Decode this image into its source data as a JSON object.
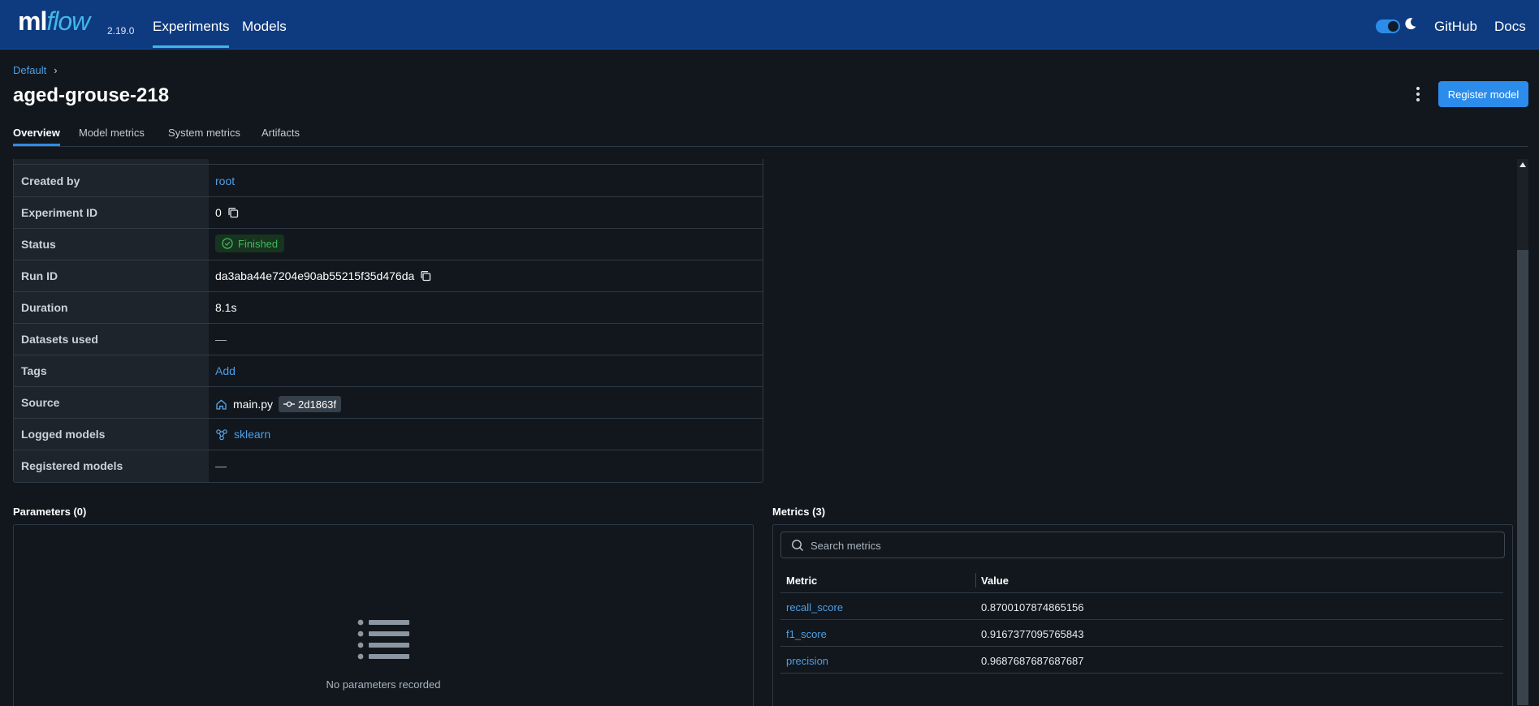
{
  "app": {
    "logo_ml": "ml",
    "logo_flow": "flow",
    "version": "2.19.0",
    "nav": [
      {
        "label": "Experiments",
        "active": true
      },
      {
        "label": "Models",
        "active": false
      }
    ],
    "links": {
      "github": "GitHub",
      "docs": "Docs"
    },
    "theme_toggle": "dark"
  },
  "breadcrumb": {
    "root": "Default",
    "separator": "›"
  },
  "run": {
    "title": "aged-grouse-218"
  },
  "actions": {
    "register_model": "Register model"
  },
  "tabs": [
    {
      "label": "Overview",
      "active": true
    },
    {
      "label": "Model metrics",
      "active": false
    },
    {
      "label": "System metrics",
      "active": false
    },
    {
      "label": "Artifacts",
      "active": false
    }
  ],
  "details": {
    "created_by": {
      "label": "Created by",
      "value": "root"
    },
    "experiment_id": {
      "label": "Experiment ID",
      "value": "0"
    },
    "status": {
      "label": "Status",
      "value": "Finished"
    },
    "run_id": {
      "label": "Run ID",
      "value": "da3aba44e7204e90ab55215f35d476da"
    },
    "duration": {
      "label": "Duration",
      "value": "8.1s"
    },
    "datasets_used": {
      "label": "Datasets used",
      "value": "—"
    },
    "tags": {
      "label": "Tags",
      "value": "Add"
    },
    "source": {
      "label": "Source",
      "file": "main.py",
      "commit": "2d1863f"
    },
    "logged_models": {
      "label": "Logged models",
      "value": "sklearn"
    },
    "registered_models": {
      "label": "Registered models",
      "value": "—"
    }
  },
  "parameters": {
    "title": "Parameters (0)",
    "empty_text": "No parameters recorded"
  },
  "metrics": {
    "title": "Metrics (3)",
    "search_placeholder": "Search metrics",
    "columns": {
      "metric": "Metric",
      "value": "Value"
    },
    "rows": [
      {
        "name": "recall_score",
        "value": "0.8700107874865156"
      },
      {
        "name": "f1_score",
        "value": "0.9167377095765843"
      },
      {
        "name": "precision",
        "value": "0.9687687687687687"
      }
    ]
  },
  "colors": {
    "topbar": "#0e3a80",
    "background": "#11171d",
    "accent": "#2c8ceb",
    "link": "#4d9fe6",
    "status_success": "#3fb95c"
  }
}
